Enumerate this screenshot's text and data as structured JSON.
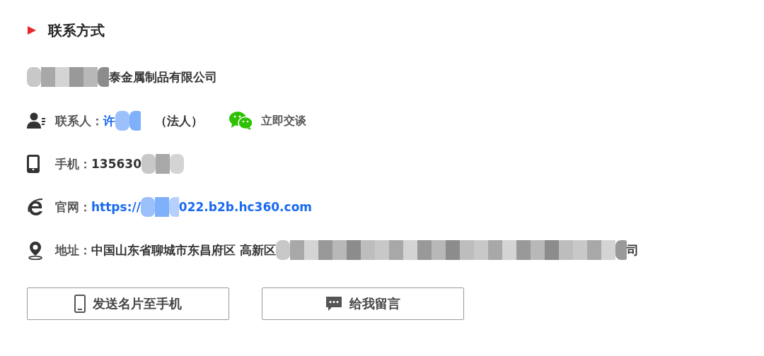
{
  "section": {
    "title": "联系方式"
  },
  "company": {
    "after": "泰金属制品有限公司"
  },
  "rows": [
    {
      "kind": "contact",
      "label": "联系人：",
      "value_before": "许",
      "value_after": "（法人）",
      "chat": "立即交谈"
    },
    {
      "kind": "phone",
      "label": "手机：",
      "value_before": "135630"
    },
    {
      "kind": "website",
      "label": "官网：",
      "value_before": "https://",
      "value_after": "022.b2b.hc360.com"
    },
    {
      "kind": "address",
      "label": "地址：",
      "value_before": "中国山东省聊城市东昌府区 高新区",
      "value_after": "司"
    }
  ],
  "buttons": [
    {
      "kind": "phone",
      "label": "发送名片至手机"
    },
    {
      "kind": "message",
      "label": "给我留言"
    }
  ]
}
